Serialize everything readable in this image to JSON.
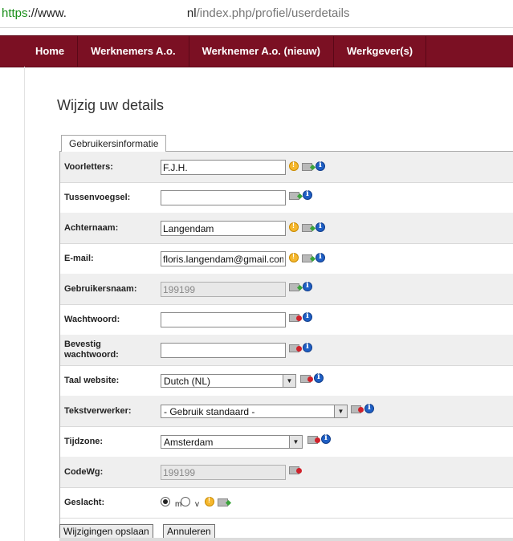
{
  "browser": {
    "url_scheme": "https",
    "url_host_start": "://www.",
    "url_host_end": "nl",
    "url_path": "/index.php/profiel/userdetails"
  },
  "nav": {
    "items": [
      "Home",
      "Werknemers A.o.",
      "Werknemer A.o. (nieuw)",
      "Werkgever(s)"
    ]
  },
  "page": {
    "title": "Wijzig uw details",
    "tab_label": "Gebruikersinformatie"
  },
  "form": {
    "voorletters": {
      "label": "Voorletters:",
      "value": "F.J.H."
    },
    "tussenvoegsel": {
      "label": "Tussenvoegsel:",
      "value": ""
    },
    "achternaam": {
      "label": "Achternaam:",
      "value": "Langendam"
    },
    "email": {
      "label": "E-mail:",
      "value": "floris.langendam@gmail.com"
    },
    "gebruikersnaam": {
      "label": "Gebruikersnaam:",
      "value": "199199"
    },
    "wachtwoord": {
      "label": "Wachtwoord:",
      "value": ""
    },
    "bevestig": {
      "label_line1": "Bevestig",
      "label_line2": "wachtwoord:",
      "value": ""
    },
    "taal": {
      "label": "Taal website:",
      "value": "Dutch (NL)"
    },
    "tekstverwerker": {
      "label": "Tekstverwerker:",
      "value": "- Gebruik standaard -"
    },
    "tijdzone": {
      "label": "Tijdzone:",
      "value": "Amsterdam"
    },
    "codewg": {
      "label": "CodeWg:",
      "value": "199199"
    },
    "geslacht": {
      "label": "Geslacht:",
      "option_m": "m",
      "option_v": "v",
      "selected": "m"
    }
  },
  "buttons": {
    "save": "Wijzigingen opslaan",
    "cancel": "Annuleren"
  },
  "colors": {
    "nav_bg": "#7b1023",
    "row_shade": "#efefef",
    "url_scheme": "#1a8f1a"
  },
  "icons": {
    "required": "warning-icon",
    "sync": "sync-icon",
    "locked": "lock-icon",
    "info": "info-icon"
  }
}
